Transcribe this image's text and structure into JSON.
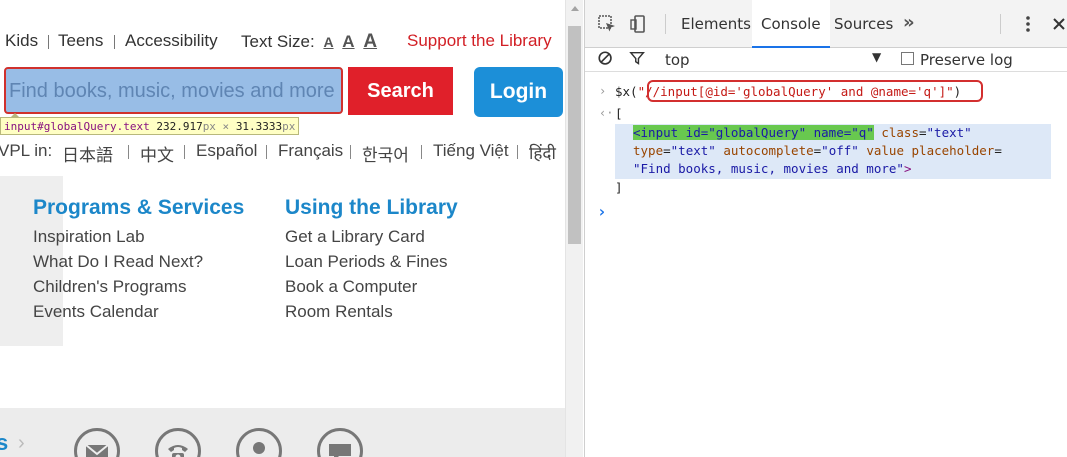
{
  "page": {
    "topnav": {
      "kids": "Kids",
      "teens": "Teens",
      "accessibility": "Accessibility",
      "text_size_label": "Text Size:",
      "text_size_options": [
        "A",
        "A",
        "A"
      ],
      "support": "Support the Library"
    },
    "search": {
      "placeholder": "Find books, music, movies and more",
      "button_label": "Search"
    },
    "login_label": "Login",
    "tooltip": {
      "selector": "input#globalQuery.text",
      "width": "232.917",
      "unit_w": "px",
      "times": " × ",
      "height": "31.3333",
      "unit_h": "px"
    },
    "languages": {
      "prefix": "VPL in:",
      "items": [
        "日本語",
        "中文",
        "Español",
        "Français",
        "한국어",
        "Tiếng Việt",
        "हिंदी"
      ]
    },
    "columns": [
      {
        "heading": "Programs & Services",
        "items": [
          "Inspiration Lab",
          "What Do I Read Next?",
          "Children's Programs",
          "Events Calendar"
        ]
      },
      {
        "heading": "Using the Library",
        "items": [
          "Get a Library Card",
          "Loan Periods & Fines",
          "Book a Computer",
          "Room Rentals"
        ]
      }
    ],
    "bottom": {
      "label": "s",
      "chevron": "›",
      "icons": [
        "envelope-icon",
        "telephone-icon",
        "person-icon",
        "chat-icon"
      ]
    }
  },
  "devtools": {
    "tabs": [
      "Elements",
      "Console",
      "Sources"
    ],
    "active_tab": "Console",
    "more_tabs": "»",
    "context": "top",
    "preserve_log": "Preserve log",
    "preserve_log_checked": false,
    "console": {
      "command_prefix": "$x(",
      "command_quote_open": "\"",
      "command_xpath": "//input[@id='globalQuery' and @name='q']",
      "command_quote_close": "\"",
      "command_suffix": ")",
      "result_open": "[",
      "result_close": "]",
      "element": {
        "open": "<input id=\"globalQuery\" name=\"q\"",
        "class_attr": "class",
        "class_val": "\"text\"",
        "type_attr": "type",
        "type_val": "\"text\"",
        "autocomplete_attr": "autocomplete",
        "autocomplete_val": "\"off\"",
        "value_attr": "value",
        "placeholder_attr": "placeholder",
        "placeholder_val": "\"Find books, music, movies and more\"",
        "close": ">"
      }
    },
    "colors": {
      "accent": "#1a73e8",
      "highlight_border": "#d32f2f",
      "match_green": "#68c84f"
    }
  }
}
